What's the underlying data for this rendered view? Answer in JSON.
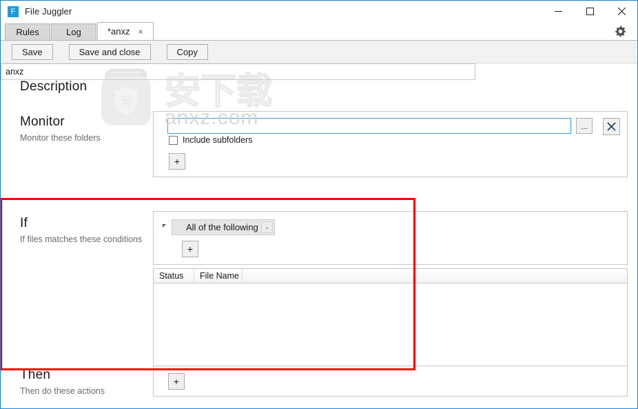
{
  "window": {
    "app_icon_letter": "F",
    "title": "File Juggler",
    "minimize": "─",
    "maximize": "☐",
    "close": "✕",
    "accent_color": "#1883d7",
    "icon_color": "#1e9bdf"
  },
  "tabs": [
    {
      "label": "Rules",
      "active": false,
      "closable": false
    },
    {
      "label": "Log",
      "active": false,
      "closable": false
    },
    {
      "label": "*anxz",
      "active": true,
      "closable": true,
      "close_glyph": "×"
    }
  ],
  "settings": {
    "icon": "gear-icon"
  },
  "toolbar": {
    "save_label": "Save",
    "save_and_close_label": "Save and close",
    "copy_label": "Copy"
  },
  "description": {
    "title": "Description",
    "value": "anxz",
    "placeholder": ""
  },
  "monitor": {
    "title": "Monitor",
    "subtitle": "Monitor these folders",
    "path_value": "",
    "path_placeholder": "",
    "browse_label": "...",
    "remove_label": "✕",
    "include_subfolders_label": "Include subfolders",
    "include_subfolders_checked": false,
    "add_label": "+"
  },
  "if_section": {
    "title": "If",
    "subtitle": "If files matches these conditions",
    "match_mode": "All of the following",
    "match_mode_arrow": "⌄",
    "add_label": "+",
    "grid": {
      "columns": [
        "Status",
        "File Name"
      ],
      "rows": []
    }
  },
  "then_section": {
    "title": "Then",
    "subtitle": "Then do these actions",
    "add_label": "+"
  },
  "annotation": {
    "color": "#fb0000",
    "target": "if-section"
  },
  "watermark": {
    "cn_text": "安下载",
    "site_text": "anxz.com",
    "color": "#c9c9c9"
  }
}
